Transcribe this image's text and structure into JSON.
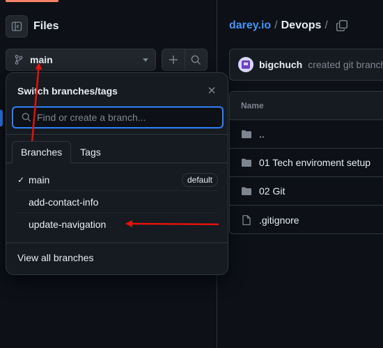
{
  "sidebar": {
    "title": "Files",
    "branch_button": {
      "label": "main"
    },
    "dropdown": {
      "title": "Switch branches/tags",
      "search_placeholder": "Find or create a branch...",
      "tabs": [
        {
          "label": "Branches"
        },
        {
          "label": "Tags"
        }
      ],
      "branches": [
        {
          "name": "main",
          "badge": "default",
          "selected": true
        },
        {
          "name": "add-contact-info"
        },
        {
          "name": "update-navigation"
        }
      ],
      "footer_link": "View all branches"
    }
  },
  "breadcrumb": {
    "owner": "darey.io",
    "sep1": "/",
    "repo": "Devops",
    "sep2": "/"
  },
  "commit": {
    "user": "bigchuch",
    "text": "created git branch"
  },
  "file_table": {
    "header": "Name",
    "rows": [
      {
        "name": "..",
        "type": "folder"
      },
      {
        "name": "01 Tech enviroment setup",
        "type": "folder"
      },
      {
        "name": "02 Git",
        "type": "folder"
      },
      {
        "name": ".gitignore",
        "type": "file"
      }
    ]
  },
  "colors": {
    "background": "#0d1117",
    "accent": "#2f81f7",
    "link": "#4493f8",
    "annotation_arrow": "#e3120b"
  },
  "icons": {
    "panel_toggle": "sidebar-collapse-icon",
    "branch": "git-branch-icon",
    "add": "plus-icon",
    "search": "search-icon",
    "close": "close-icon",
    "check": "check-icon",
    "copy": "copy-icon",
    "folder": "folder-icon",
    "file": "file-icon"
  }
}
